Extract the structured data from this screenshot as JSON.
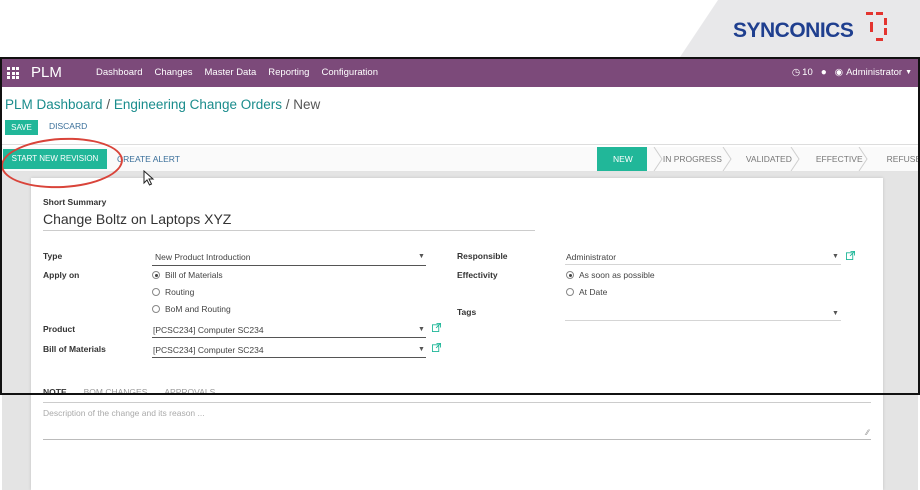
{
  "brand": {
    "name": "SYNCONICS",
    "color": "#1f3f8f",
    "accent": "#e3342f"
  },
  "topbar": {
    "app_name": "PLM",
    "menu": [
      "Dashboard",
      "Changes",
      "Master Data",
      "Reporting",
      "Configuration"
    ],
    "activity_count": "10",
    "user": "Administrator",
    "color": "#7c4a7a"
  },
  "breadcrumb": {
    "items": [
      "PLM Dashboard",
      "Engineering Change Orders"
    ],
    "current": "New",
    "sep": "/"
  },
  "actions": {
    "save": "SAVE",
    "discard": "DISCARD"
  },
  "header_buttons": {
    "start_revision": "START NEW REVISION",
    "create_alert": "CREATE ALERT"
  },
  "stages": [
    "NEW",
    "IN PROGRESS",
    "VALIDATED",
    "EFFECTIVE",
    "REFUSED"
  ],
  "active_stage": "NEW",
  "form": {
    "short_summary_label": "Short Summary",
    "short_summary": "Change Boltz on Laptops XYZ",
    "type_label": "Type",
    "type_value": "New Product Introduction",
    "apply_on_label": "Apply on",
    "apply_on_options": [
      "Bill of Materials",
      "Routing",
      "BoM and Routing"
    ],
    "apply_on_selected": "Bill of Materials",
    "product_label": "Product",
    "product_value": "[PCSC234] Computer SC234",
    "bom_label": "Bill of Materials",
    "bom_value": "[PCSC234] Computer SC234",
    "responsible_label": "Responsible",
    "responsible_value": "Administrator",
    "effectivity_label": "Effectivity",
    "effectivity_options": [
      "As soon as possible",
      "At Date"
    ],
    "effectivity_selected": "As soon as possible",
    "tags_label": "Tags",
    "tags_value": ""
  },
  "tabs": [
    "NOTE",
    "BOM CHANGES",
    "APPROVALS"
  ],
  "active_tab": "NOTE",
  "note_placeholder": "Description of the change and its reason ...",
  "colors": {
    "primary": "#21b799",
    "link": "#1a8c8c",
    "annotation": "#d9443a"
  }
}
